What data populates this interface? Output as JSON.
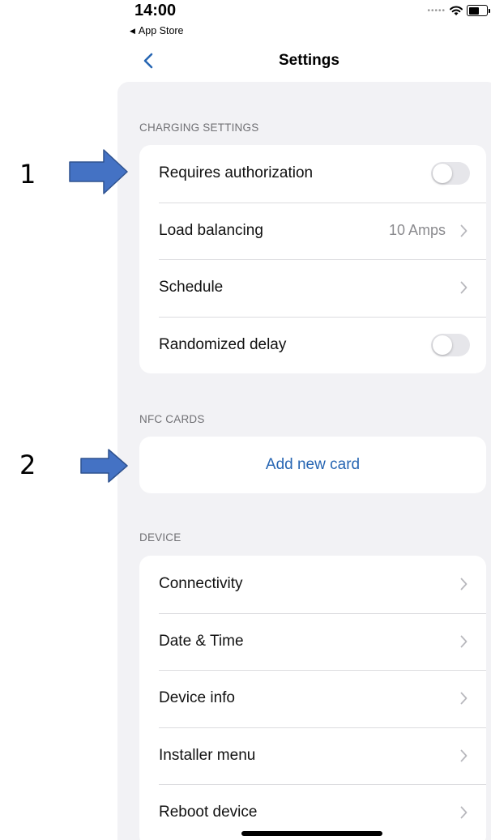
{
  "status_bar": {
    "time": "14:00",
    "back_app": "App Store"
  },
  "nav": {
    "title": "Settings"
  },
  "sections": {
    "charging": {
      "header": "CHARGING SETTINGS",
      "rows": [
        {
          "label": "Requires authorization",
          "type": "toggle",
          "on": false
        },
        {
          "label": "Load balancing",
          "value": "10 Amps",
          "type": "disclosure"
        },
        {
          "label": "Schedule",
          "type": "disclosure"
        },
        {
          "label": "Randomized delay",
          "type": "toggle",
          "on": false
        }
      ]
    },
    "nfc": {
      "header": "NFC CARDS",
      "button": "Add new card"
    },
    "device": {
      "header": "DEVICE",
      "rows": [
        {
          "label": "Connectivity"
        },
        {
          "label": "Date & Time"
        },
        {
          "label": "Device info"
        },
        {
          "label": "Installer menu"
        },
        {
          "label": "Reboot device"
        }
      ]
    }
  },
  "annotations": {
    "marker_1": "1",
    "marker_2": "2"
  },
  "colors": {
    "accent": "#2766b3",
    "arrow_fill": "#4472c4",
    "arrow_stroke": "#2f528f",
    "panel_bg": "#f2f2f5"
  }
}
